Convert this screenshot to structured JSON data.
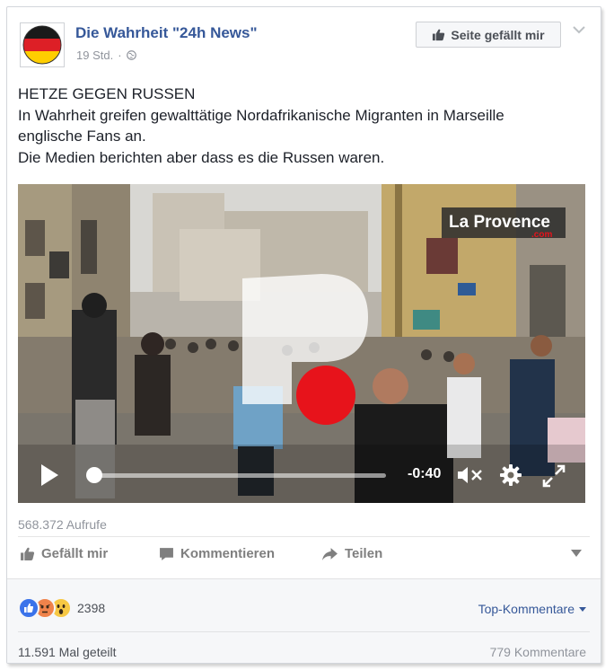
{
  "post": {
    "page_name": "Die Wahrheit \"24h News\"",
    "time": "19 Std.",
    "separator": "·",
    "audience_icon": "globe-icon",
    "like_page_label": "Seite gefällt mir",
    "text_lines": [
      "HETZE GEGEN RUSSEN",
      "In Wahrheit greifen gewalttätige Nordafrikanische Migranten in Marseille",
      "englische Fans an.",
      "Die Medien berichten aber dass es die Russen waren."
    ]
  },
  "video": {
    "watermark_brand": "La Provence",
    "watermark_suffix": ".com",
    "time_remaining": "-0:40",
    "progress_fraction": 0.02
  },
  "stats": {
    "views": "568.372 Aufrufe",
    "reaction_count": "2398",
    "reactions": [
      "like",
      "angry",
      "wow"
    ],
    "shares": "11.591 Mal geteilt",
    "comments": "779 Kommentare"
  },
  "actions": {
    "like": "Gefällt mir",
    "comment": "Kommentieren",
    "share": "Teilen"
  },
  "comments_sort": "Top-Kommentare",
  "colors": {
    "link": "#365899",
    "muted": "#90949c",
    "text": "#1d2129",
    "like_blue": "#3b73ea",
    "angry_orange": "#f0834b",
    "wow_yellow": "#f7c844"
  }
}
